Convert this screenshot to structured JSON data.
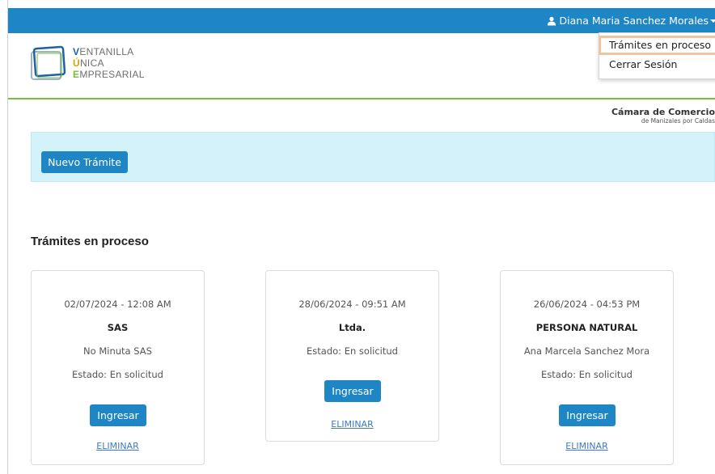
{
  "user": {
    "name": "Diana Maria Sanchez Morales"
  },
  "dropdown": {
    "items": [
      "Trámites en proceso",
      "Cerrar Sesión"
    ]
  },
  "logo": {
    "line1_initial": "V",
    "line1_rest": "ENTANILLA",
    "line2_initial": "Ú",
    "line2_rest": "NICA",
    "line3_initial": "E",
    "line3_rest": "MPRESARIAL"
  },
  "camara": {
    "line1": "Cámara de Comercio",
    "line2": "de Manizales por Caldas"
  },
  "banner": {
    "new_button": "Nuevo Trámite"
  },
  "section": {
    "title": "Trámites en proceso"
  },
  "cards": [
    {
      "datetime": "02/07/2024 - 12:08 AM",
      "type": "SAS",
      "name": "No Minuta SAS",
      "status": "Estado: En solicitud",
      "enter_label": "Ingresar",
      "delete_label": "ELIMINAR"
    },
    {
      "datetime": "28/06/2024 - 09:51 AM",
      "type": "Ltda.",
      "status": "Estado: En solicitud",
      "enter_label": "Ingresar",
      "delete_label": "ELIMINAR"
    },
    {
      "datetime": "26/06/2024 - 04:53 PM",
      "type": "PERSONA NATURAL",
      "name": "Ana Marcela Sanchez Mora",
      "status": "Estado: En solicitud",
      "enter_label": "Ingresar",
      "delete_label": "ELIMINAR"
    }
  ],
  "colors": {
    "primary": "#1f86c6",
    "banner_bg": "#d3f2f9",
    "header_rule": "#7dbb3a",
    "link": "#3c78c8",
    "highlight": "#f0c4a0"
  }
}
